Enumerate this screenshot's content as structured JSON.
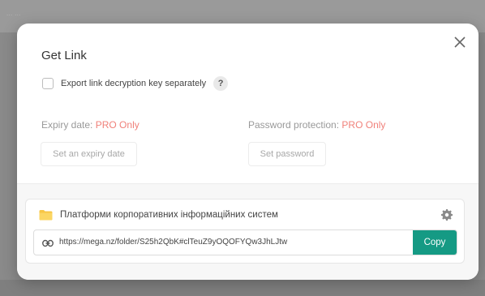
{
  "backdrop": {
    "text": "... ..."
  },
  "dialog": {
    "title": "Get Link",
    "export_option": {
      "label": "Export link decryption key separately",
      "checked": false,
      "help": "?"
    },
    "expiry": {
      "label": "Expiry date:",
      "pro": "PRO Only",
      "button": "Set an expiry date"
    },
    "password": {
      "label": "Password protection:",
      "pro": "PRO Only",
      "button": "Set password"
    },
    "link": {
      "folder_name": "Платформи корпоративних інформаційних систем",
      "url": "https://mega.nz/folder/S25h2QbK#clTeuZ9yOQOFYQw3JhLJtw",
      "copy_label": "Copy"
    }
  },
  "colors": {
    "accent": "#159a84",
    "pro": "#f0817a",
    "folder": "#f7c646"
  }
}
